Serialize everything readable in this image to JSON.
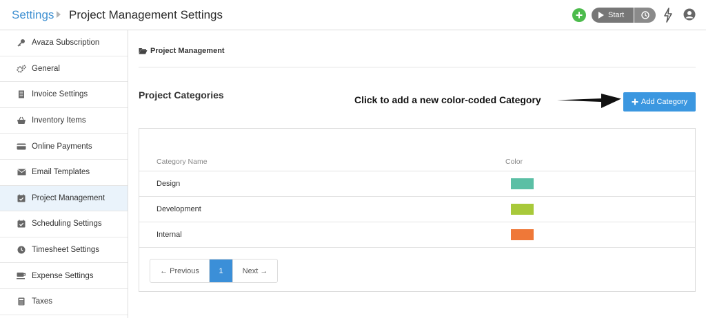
{
  "header": {
    "root": "Settings",
    "title": "Project Management Settings",
    "start_label": "Start"
  },
  "sidebar": {
    "items": [
      {
        "label": "Avaza Subscription",
        "icon": "key-icon"
      },
      {
        "label": "General",
        "icon": "gears-icon"
      },
      {
        "label": "Invoice Settings",
        "icon": "document-icon"
      },
      {
        "label": "Inventory Items",
        "icon": "basket-icon"
      },
      {
        "label": "Online Payments",
        "icon": "credit-card-icon"
      },
      {
        "label": "Email Templates",
        "icon": "envelope-icon"
      },
      {
        "label": "Project Management",
        "icon": "calendar-check-icon",
        "active": true
      },
      {
        "label": "Scheduling Settings",
        "icon": "calendar-check-icon"
      },
      {
        "label": "Timesheet Settings",
        "icon": "clock-icon"
      },
      {
        "label": "Expense Settings",
        "icon": "coffee-icon"
      },
      {
        "label": "Taxes",
        "icon": "calculator-icon"
      }
    ]
  },
  "main": {
    "section_heading": "Project Management",
    "categories_title": "Project Categories",
    "annotation": "Click to add a new color-coded Category",
    "add_button": "Add Category",
    "table": {
      "headers": [
        "Category Name",
        "Color"
      ],
      "rows": [
        {
          "name": "Design",
          "color": "#5bbfa5"
        },
        {
          "name": "Development",
          "color": "#a8c93a"
        },
        {
          "name": "Internal",
          "color": "#ef7838"
        }
      ]
    },
    "pagination": {
      "previous": "← Previous",
      "current": "1",
      "next": "Next →"
    }
  },
  "colors": {
    "accent": "#3b97e0",
    "plus_green": "#4cbb4c"
  }
}
